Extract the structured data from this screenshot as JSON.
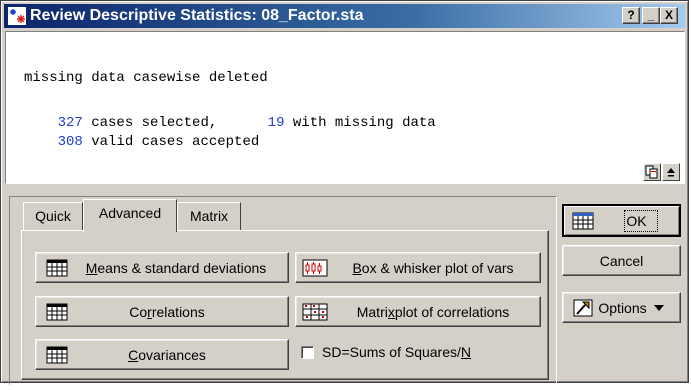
{
  "window": {
    "title": "Review Descriptive Statistics: 08_Factor.sta",
    "help_label": "?",
    "minimize_label": "_",
    "close_label": "X"
  },
  "results": {
    "line1": "missing data casewise deleted",
    "selected_count": "327",
    "selected_text": " cases selected,",
    "missing_count": "19",
    "missing_text": " with missing data",
    "valid_count": "308",
    "valid_text": " valid cases accepted"
  },
  "tabs": [
    {
      "label": "Quick"
    },
    {
      "label": "Advanced"
    },
    {
      "label": "Matrix"
    }
  ],
  "buttons": {
    "means_pre": "M",
    "means_rest": "eans & standard deviations",
    "boxwhisker_pre": "B",
    "boxwhisker_rest": "ox & whisker plot of vars",
    "correlations_pre": "Co",
    "correlations_u": "r",
    "correlations_rest": "relations",
    "matrixplot_pre": "Matri",
    "matrixplot_u": "x",
    "matrixplot_rest": " plot of correlations",
    "covariances_u": "C",
    "covariances_rest": "ovariances",
    "ok": "OK",
    "cancel": "Cancel",
    "options": "Options"
  },
  "checkbox": {
    "label_pre": "SD=Sums of Squares/",
    "label_u": "N",
    "checked": false
  },
  "icons": [
    "app-icon",
    "table-icon",
    "box-whisker-icon",
    "matrix-plot-icon",
    "options-icon",
    "copy-icon",
    "collapse-icon"
  ]
}
